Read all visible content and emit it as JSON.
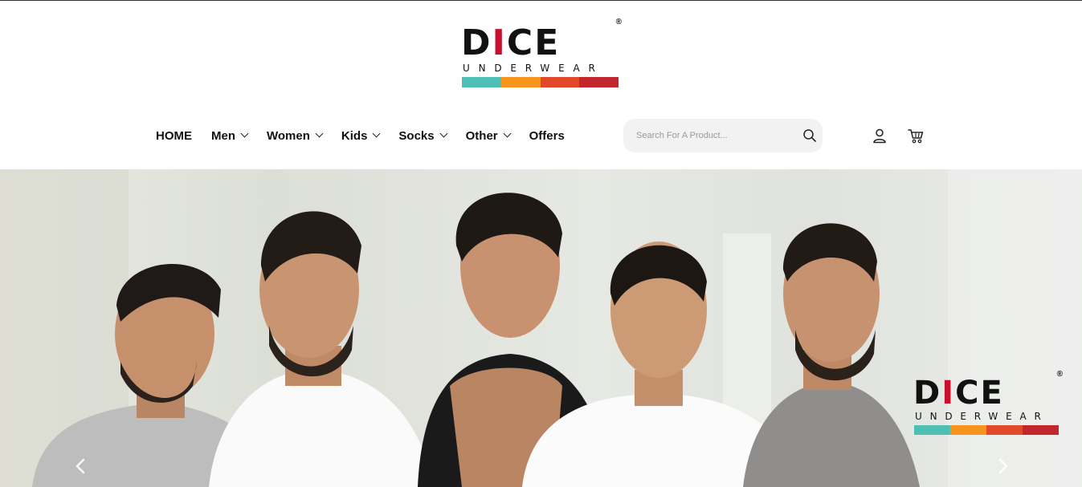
{
  "brand": {
    "name_prefix": "D",
    "name_accent": "I",
    "name_suffix": "CE",
    "registered": "®",
    "tagline": "UNDERWEAR",
    "stripe_colors": [
      "#4dbfb4",
      "#f7941d",
      "#e2492b",
      "#c1272d"
    ]
  },
  "nav": {
    "items": [
      {
        "label": "HOME",
        "has_dropdown": false
      },
      {
        "label": "Men",
        "has_dropdown": true
      },
      {
        "label": "Women",
        "has_dropdown": true
      },
      {
        "label": "Kids",
        "has_dropdown": true
      },
      {
        "label": "Socks",
        "has_dropdown": true
      },
      {
        "label": "Other",
        "has_dropdown": true
      },
      {
        "label": "Offers",
        "has_dropdown": false
      }
    ]
  },
  "search": {
    "placeholder": "Search For A Product...",
    "value": "",
    "icon": "search-icon"
  },
  "header_icons": [
    "user-icon",
    "cart-icon"
  ],
  "hero": {
    "slide_icons": [
      "chevron-left-icon",
      "chevron-right-icon"
    ],
    "colors": {
      "background": "#e3e5df",
      "accent": "#c8102e"
    }
  }
}
